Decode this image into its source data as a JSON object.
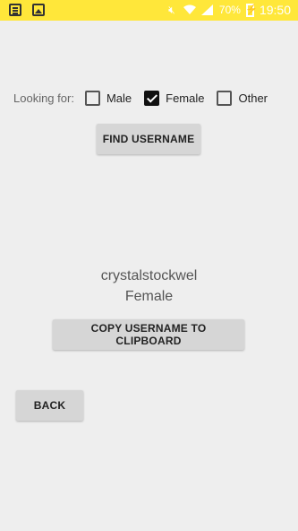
{
  "status_bar": {
    "icons_left": [
      "notes-icon",
      "image-icon"
    ],
    "battery_percent": "70%",
    "time": "19:50",
    "icons_right": [
      "mute-icon",
      "wifi-icon",
      "signal-icon",
      "battery-charging-icon"
    ]
  },
  "filter": {
    "label": "Looking for:",
    "options": [
      {
        "label": "Male",
        "checked": false
      },
      {
        "label": "Female",
        "checked": true
      },
      {
        "label": "Other",
        "checked": false
      }
    ]
  },
  "buttons": {
    "find": "FIND USERNAME",
    "copy": "COPY USERNAME TO CLIPBOARD",
    "back": "BACK"
  },
  "result": {
    "username": "crystalstockwel",
    "gender": "Female"
  },
  "colors": {
    "status_bar": "#ffe73a",
    "background": "#eeeeee",
    "button": "#d6d6d6"
  }
}
